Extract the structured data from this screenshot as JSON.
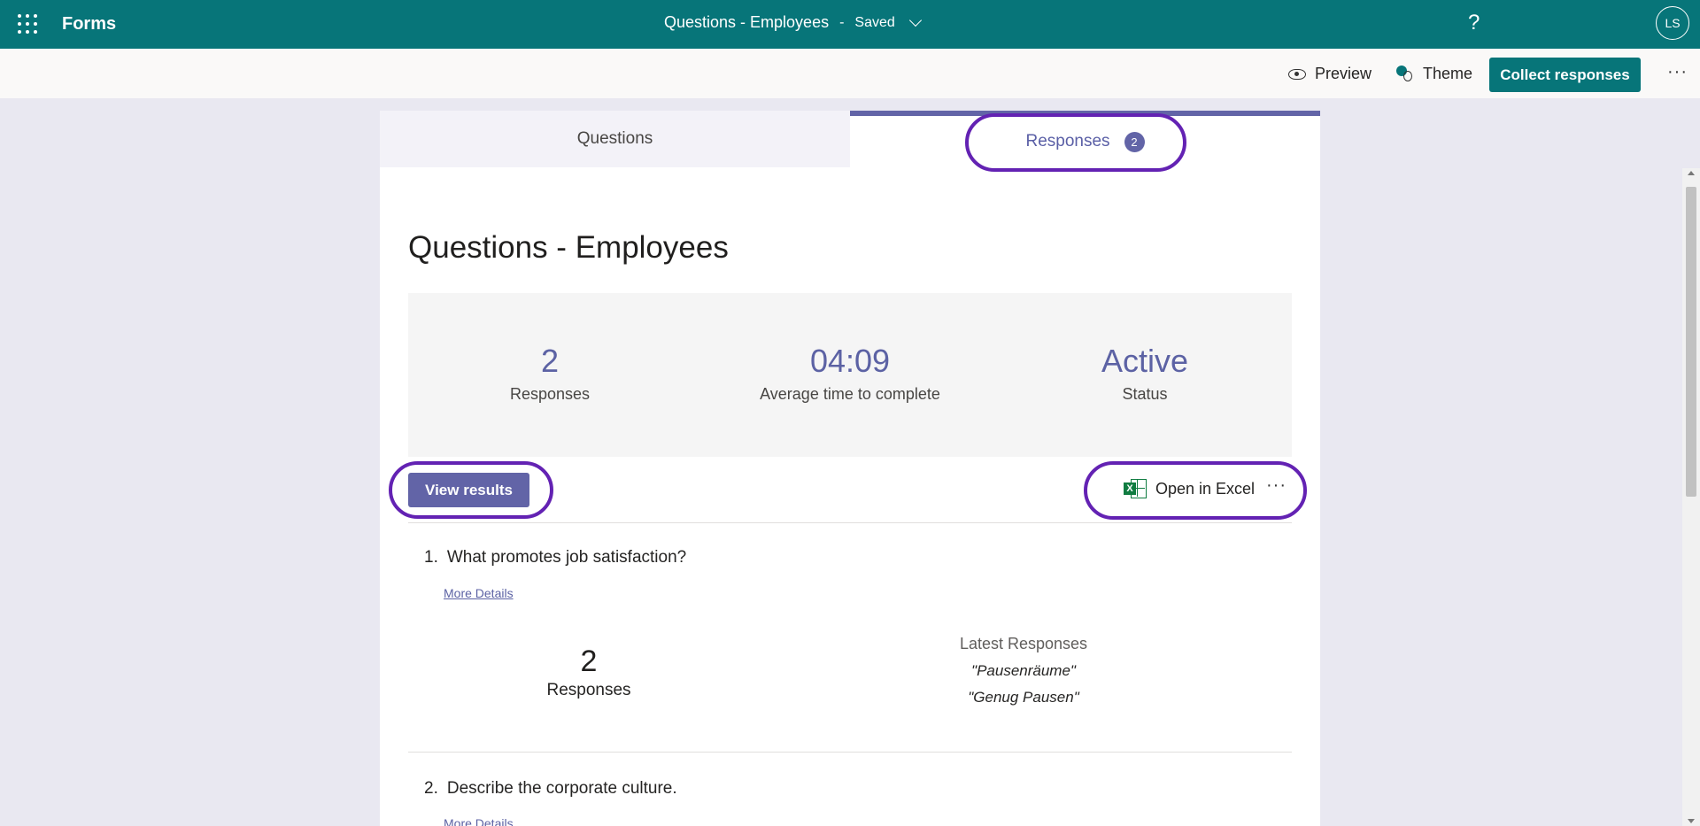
{
  "app": {
    "name": "Forms"
  },
  "header": {
    "doc_title": "Questions - Employees",
    "separator": "-",
    "save_status": "Saved",
    "help": "?",
    "avatar_initials": "LS"
  },
  "toolbar": {
    "preview_label": "Preview",
    "theme_label": "Theme",
    "collect_label": "Collect responses",
    "more": "···"
  },
  "tabs": {
    "questions_label": "Questions",
    "responses_label": "Responses",
    "responses_count": "2"
  },
  "form": {
    "title": "Questions - Employees"
  },
  "summary": {
    "responses_value": "2",
    "responses_label": "Responses",
    "avg_time_value": "04:09",
    "avg_time_label": "Average time to complete",
    "status_value": "Active",
    "status_label": "Status"
  },
  "actions": {
    "view_results_label": "View results",
    "open_excel_label": "Open in Excel",
    "more": "···"
  },
  "questions": [
    {
      "number": "1.",
      "text": "What promotes job satisfaction?",
      "more_details": "More Details",
      "count": "2",
      "count_label": "Responses",
      "latest_header": "Latest Responses",
      "latest": [
        "\"Pausenräume\"",
        "\"Genug Pausen\""
      ]
    },
    {
      "number": "2.",
      "text": "Describe the corporate culture.",
      "more_details": "More Details"
    }
  ],
  "colors": {
    "brand": "#077579",
    "accent": "#6264a7",
    "highlight": "#6322b3"
  },
  "icons": [
    "waffle-icon",
    "chevron-down-icon",
    "help-icon",
    "eye-icon",
    "theme-icon",
    "excel-icon",
    "more-icon"
  ]
}
